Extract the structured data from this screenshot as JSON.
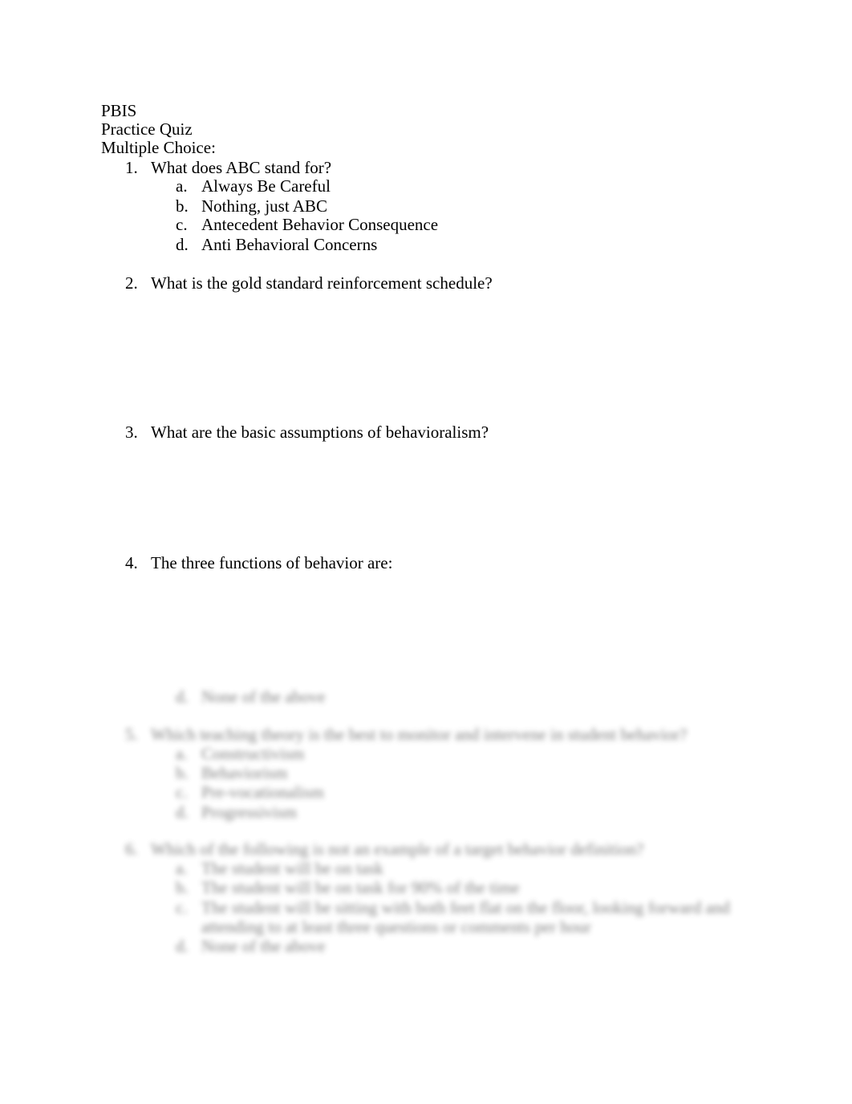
{
  "header": {
    "line1": "PBIS",
    "line2": "Practice Quiz",
    "line3": "Multiple Choice:"
  },
  "questions": [
    {
      "number": "1.",
      "text": "What does ABC stand for?",
      "options": [
        {
          "letter": "a.",
          "text": "Always Be Careful"
        },
        {
          "letter": "b.",
          "text": "Nothing, just ABC"
        },
        {
          "letter": "c.",
          "text": "Antecedent Behavior Consequence"
        },
        {
          "letter": "d.",
          "text": "Anti Behavioral Concerns"
        }
      ]
    },
    {
      "number": "2.",
      "text": "What is the gold standard reinforcement schedule?"
    },
    {
      "number": "3.",
      "text": "What are the basic assumptions of behavioralism?"
    },
    {
      "number": "4.",
      "text": "The three functions of behavior are:"
    }
  ],
  "blurred": {
    "q4_option_d": {
      "letter": "d.",
      "text": "None of the above"
    },
    "q5": {
      "number": "5.",
      "text": "Which teaching theory is the best to monitor and intervene in student behavior?",
      "options": [
        {
          "letter": "a.",
          "text": "Constructivism"
        },
        {
          "letter": "b.",
          "text": "Behaviorism"
        },
        {
          "letter": "c.",
          "text": "Pre-vocationalism"
        },
        {
          "letter": "d.",
          "text": "Progressivism"
        }
      ]
    },
    "q6": {
      "number": "6.",
      "text": "Which of the following is not an example of a target behavior definition?",
      "options": [
        {
          "letter": "a.",
          "text": "The student will be on task"
        },
        {
          "letter": "b.",
          "text": "The student will be on task for 90% of the time"
        },
        {
          "letter": "c.",
          "text": "The student will be sitting with both feet flat on the floor, looking forward and"
        },
        {
          "letter": "",
          "text": "attending to at least three questions or comments per hour"
        },
        {
          "letter": "d.",
          "text": "None of the above"
        }
      ]
    }
  }
}
